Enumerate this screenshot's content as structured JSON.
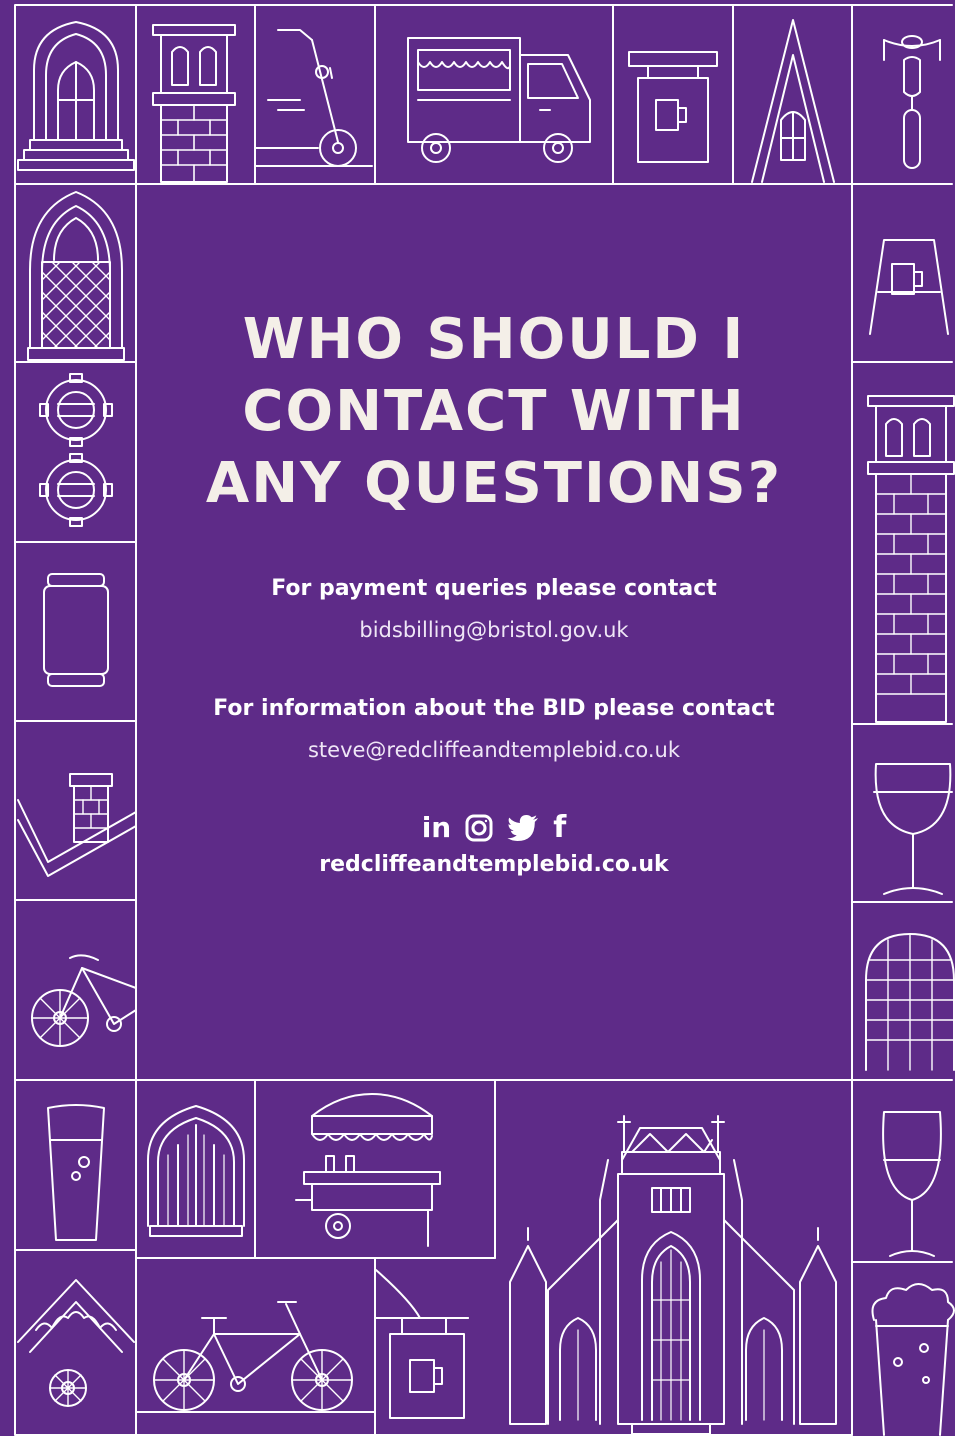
{
  "poster": {
    "title_lines": [
      "WHO SHOULD I",
      "CONTACT WITH",
      "ANY QUESTIONS?"
    ],
    "payment": {
      "label": "For payment queries please contact",
      "email": "bidsbilling@bristol.gov.uk"
    },
    "info": {
      "label": "For information about the BID please contact",
      "email": "steve@redcliffeandtemplebid.co.uk"
    },
    "social": {
      "icons": [
        "linkedin-icon",
        "instagram-icon",
        "twitter-icon",
        "facebook-icon"
      ],
      "linkedin_text": "in",
      "facebook_text": "f"
    },
    "website": "redcliffeandtemplebid.co.uk"
  },
  "colors": {
    "background": "#5e2b88",
    "line": "#ffffff",
    "title": "#f4efe8"
  }
}
